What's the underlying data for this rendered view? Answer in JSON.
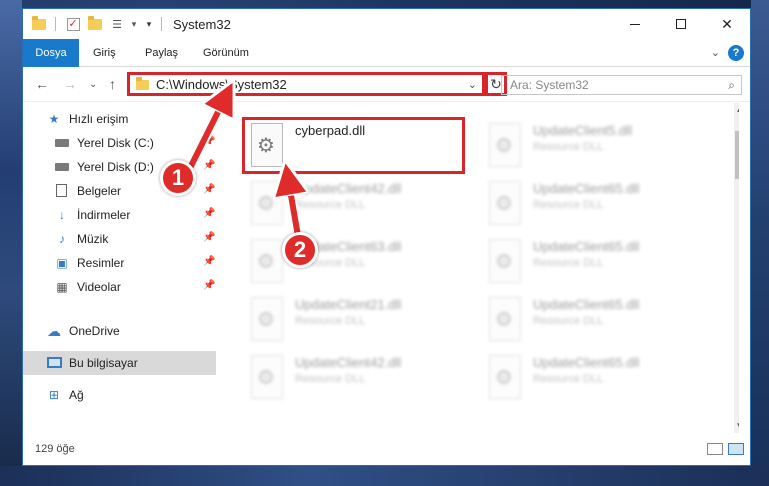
{
  "window": {
    "title": "System32"
  },
  "ribbon": {
    "tabs": [
      {
        "label": "Dosya",
        "active": true
      },
      {
        "label": "Giriş",
        "active": false
      },
      {
        "label": "Paylaş",
        "active": false
      },
      {
        "label": "Görünüm",
        "active": false
      }
    ]
  },
  "navigation": {
    "address": "C:\\Windows\\System32",
    "search_placeholder": "Ara: System32"
  },
  "sidebar": {
    "items": [
      {
        "label": "Hızlı erişim",
        "icon": "star-icon",
        "pinned": false
      },
      {
        "label": "Yerel Disk (C:)",
        "icon": "drive-icon",
        "pinned": true
      },
      {
        "label": "Yerel Disk (D:)",
        "icon": "drive-icon",
        "pinned": true
      },
      {
        "label": "Belgeler",
        "icon": "documents-icon",
        "pinned": true
      },
      {
        "label": "İndirmeler",
        "icon": "download-icon",
        "pinned": true
      },
      {
        "label": "Müzik",
        "icon": "music-icon",
        "pinned": true
      },
      {
        "label": "Resimler",
        "icon": "pictures-icon",
        "pinned": true
      },
      {
        "label": "Videolar",
        "icon": "videos-icon",
        "pinned": true
      },
      {
        "label": "OneDrive",
        "icon": "cloud-icon",
        "pinned": false
      },
      {
        "label": "Bu bilgisayar",
        "icon": "computer-icon",
        "pinned": false,
        "selected": true
      },
      {
        "label": "Ağ",
        "icon": "network-icon",
        "pinned": false
      }
    ]
  },
  "files": {
    "left": [
      {
        "name": "cyberpad.dll",
        "type": "",
        "blurred": false
      },
      {
        "name": "UpdateClient42.dll",
        "type": "Resource DLL",
        "blurred": true
      },
      {
        "name": "UpdateClient63.dll",
        "type": "Resource DLL",
        "blurred": true
      },
      {
        "name": "UpdateClient21.dll",
        "type": "Resource DLL",
        "blurred": true
      },
      {
        "name": "UpdateClient42.dll",
        "type": "Resource DLL",
        "blurred": true
      }
    ],
    "right": [
      {
        "name": "UpdateClient5.dll",
        "type": "Resource DLL",
        "blurred": true
      },
      {
        "name": "UpdateClient65.dll",
        "type": "Resource DLL",
        "blurred": true
      },
      {
        "name": "UpdateClient65.dll",
        "type": "Resource DLL",
        "blurred": true
      },
      {
        "name": "UpdateClient65.dll",
        "type": "Resource DLL",
        "blurred": true
      },
      {
        "name": "UpdateClient65.dll",
        "type": "Resource DLL",
        "blurred": true
      }
    ]
  },
  "status": {
    "item_count": "129 öğe"
  },
  "annotations": {
    "step1": "1",
    "step2": "2"
  },
  "colors": {
    "accent": "#1979ca",
    "highlight": "#d7262b",
    "folder": "#f4cd58"
  }
}
